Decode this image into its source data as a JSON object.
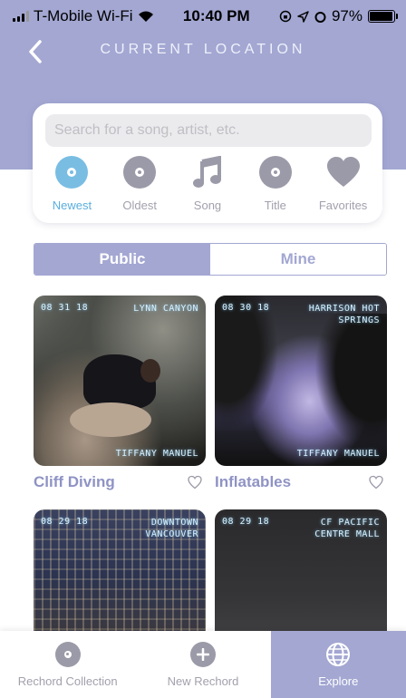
{
  "status_bar": {
    "carrier": "T-Mobile Wi-Fi",
    "time": "10:40 PM",
    "battery_text": "97%",
    "battery_level": 0.97
  },
  "header": {
    "title": "CURRENT LOCATION",
    "back_icon": "chevron-left-icon"
  },
  "search": {
    "placeholder": "Search for a song, artist, etc.",
    "value": ""
  },
  "filters": [
    {
      "label": "Newest",
      "icon": "disc-icon",
      "active": true
    },
    {
      "label": "Oldest",
      "icon": "disc-icon",
      "active": false
    },
    {
      "label": "Song",
      "icon": "music-note-icon",
      "active": false
    },
    {
      "label": "Title",
      "icon": "disc-icon",
      "active": false
    },
    {
      "label": "Favorites",
      "icon": "heart-icon",
      "active": false
    }
  ],
  "segment": {
    "public_label": "Public",
    "mine_label": "Mine",
    "selected": "Public"
  },
  "cards": [
    {
      "date": "08 31 18",
      "location": "LYNN CANYON",
      "artist": "TIFFANY MANUEL",
      "title": "Cliff Diving"
    },
    {
      "date": "08 30 18",
      "location": "HARRISON HOT SPRINGS",
      "artist": "TIFFANY MANUEL",
      "title": "Inflatables"
    },
    {
      "date": "08 29 18",
      "location": "DOWNTOWN VANCOUVER",
      "artist": "",
      "title": ""
    },
    {
      "date": "08 29 18",
      "location": "CF PACIFIC CENTRE MALL",
      "artist": "",
      "title": ""
    }
  ],
  "bottom_nav": [
    {
      "label": "Rechord Collection",
      "icon": "disc-icon",
      "active": false
    },
    {
      "label": "New Rechord",
      "icon": "plus-circle-icon",
      "active": false
    },
    {
      "label": "Explore",
      "icon": "globe-icon",
      "active": true
    }
  ],
  "colors": {
    "brand": "#a3a7d2",
    "accent_blue": "#79bde3",
    "muted_gray": "#9b9aa8"
  }
}
